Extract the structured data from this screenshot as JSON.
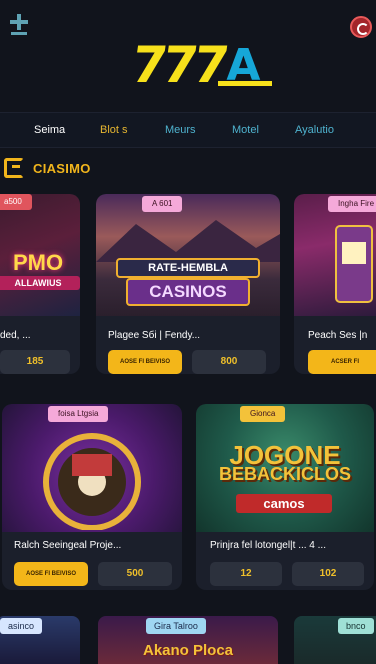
{
  "brand": {
    "logo_number": "777",
    "logo_letter": "A"
  },
  "header": {
    "left_icon": "menu-plus-icon",
    "right_icon": "user-badge-icon"
  },
  "nav": {
    "items": [
      {
        "label": "Seima",
        "active": true
      },
      {
        "label": "Blot s"
      },
      {
        "label": "Meurs"
      },
      {
        "label": "Motel"
      },
      {
        "label": "Ayalutio"
      }
    ]
  },
  "section": {
    "icon": "casino-icon",
    "title": "CIASIMO"
  },
  "cards": [
    {
      "badge": "a500",
      "art": [
        "PMO",
        "ALLAWIUS"
      ],
      "title": "ded, ...",
      "play": "",
      "value": "185"
    },
    {
      "badge": "A 601",
      "art": [
        "RATE-HEMBLA",
        "CASINOS"
      ],
      "title": "Plagee Sбi | Fendy...",
      "play": "AOSE FI BEIVISO",
      "value": "800"
    },
    {
      "badge": "Ingha Fire",
      "art": [
        "",
        ""
      ],
      "title": "Peach Ses |n",
      "play": "ACSER FI",
      "value": ""
    },
    {
      "badge": "foisa Ltgsia",
      "art": [
        "",
        ""
      ],
      "title": "Ralch Seeingeal Proje...",
      "play": "AOSE FI BEIVISO",
      "value": "500"
    },
    {
      "badge": "Gionca",
      "art": [
        "JOGONE",
        "BEBACKICLOS",
        "camos"
      ],
      "title": "Prinjra fel lotongel|t ... 4 ...",
      "play": "",
      "value": "12",
      "value2": "102"
    }
  ],
  "bottom_cards": [
    {
      "badge": "asinco"
    },
    {
      "badge": "Gira Talroo",
      "art": "Akano Ploca"
    },
    {
      "badge": "bnco"
    }
  ],
  "colors": {
    "accent": "#f3b619",
    "brand_yellow": "#f7e11b",
    "brand_blue": "#16a7d8",
    "bg": "#11141c",
    "card": "#1b1f2b"
  }
}
